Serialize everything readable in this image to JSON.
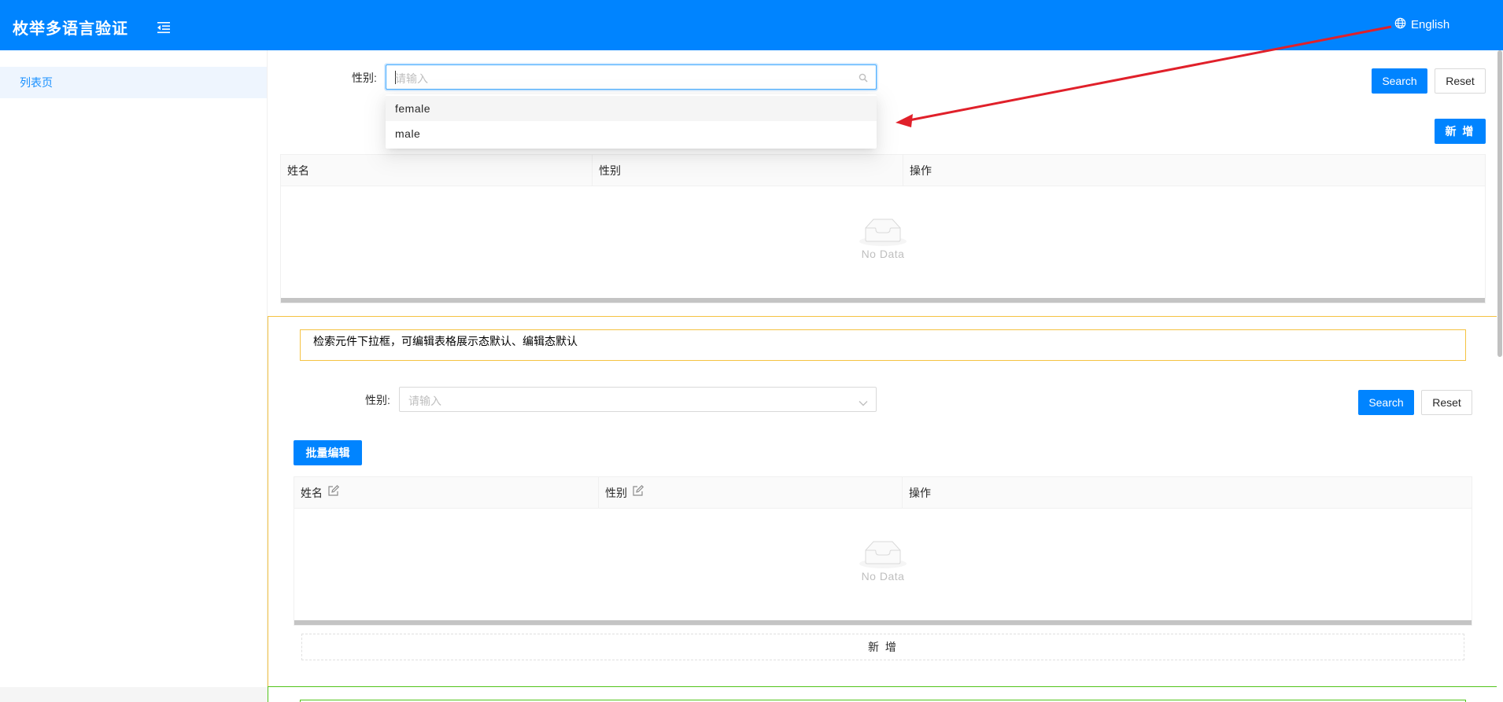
{
  "header": {
    "title": "枚举多语言验证",
    "menu_icon": "menu-fold-icon",
    "language_label": "English",
    "language_icon": "globe-icon",
    "bg_color": "#0084ff"
  },
  "sidebar": {
    "items": [
      {
        "label": "列表页",
        "active": true
      }
    ]
  },
  "section1": {
    "filter_label": "性别:",
    "filter_placeholder": "请输入",
    "search_label": "Search",
    "reset_label": "Reset",
    "add_label": "新 增",
    "dropdown_options": [
      "female",
      "male"
    ],
    "columns": [
      "姓名",
      "性别",
      "操作"
    ],
    "empty_text": "No Data"
  },
  "section2": {
    "description": "检索元件下拉框，可编辑表格展示态默认、编辑态默认",
    "filter_label": "性别:",
    "filter_placeholder": "请输入",
    "search_label": "Search",
    "reset_label": "Reset",
    "batch_edit_label": "批量编辑",
    "columns": [
      "姓名",
      "性别",
      "操作"
    ],
    "empty_text": "No Data",
    "add_row_label": "新 增"
  },
  "colors": {
    "primary": "#0084ff",
    "annotation_arrow": "#e0202a",
    "yellow_border": "#f5c342",
    "green_border": "#52c41a"
  }
}
